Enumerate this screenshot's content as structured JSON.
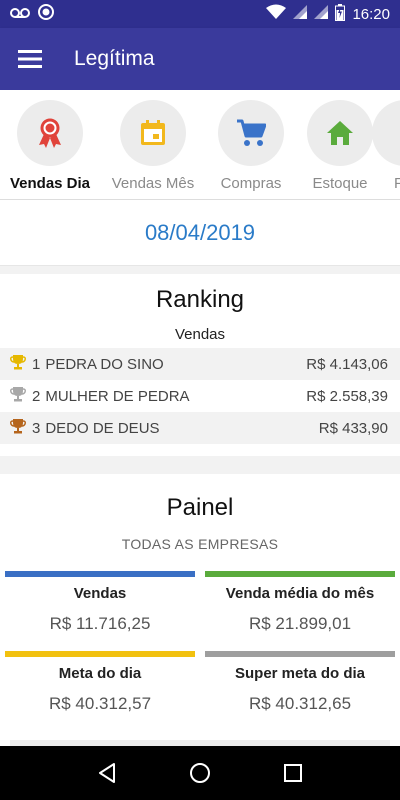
{
  "status_bar": {
    "time": "16:20"
  },
  "app_bar": {
    "title": "Legítima"
  },
  "tabs": [
    {
      "label": "Vendas Dia",
      "icon": "award-ribbon-icon",
      "color": "#e0433a",
      "active": true
    },
    {
      "label": "Vendas Mês",
      "icon": "calendar-icon",
      "color": "#f2b81c",
      "active": false
    },
    {
      "label": "Compras",
      "icon": "shopping-cart-icon",
      "color": "#3a73c9",
      "active": false
    },
    {
      "label": "Estoque",
      "icon": "home-icon",
      "color": "#5aab3c",
      "active": false
    },
    {
      "label": "F",
      "icon": "partial-tab",
      "color": "#888888",
      "active": false
    }
  ],
  "date": "08/04/2019",
  "ranking": {
    "title": "Ranking",
    "subtitle": "Vendas",
    "rows": [
      {
        "position": "1",
        "name": "PEDRA DO SINO",
        "value": "R$ 4.143,06",
        "trophy_color": "#e6b800"
      },
      {
        "position": "2",
        "name": "MULHER DE PEDRA",
        "value": "R$ 2.558,39",
        "trophy_color": "#a8a8a8"
      },
      {
        "position": "3",
        "name": "DEDO DE DEUS",
        "value": "R$ 433,90",
        "trophy_color": "#b5651d"
      }
    ]
  },
  "painel": {
    "title": "Painel",
    "subtitle": "TODAS AS EMPRESAS",
    "cards": [
      {
        "label": "Vendas",
        "value": "R$ 11.716,25",
        "color": "#3a6fc4"
      },
      {
        "label": "Venda média do mês",
        "value": "R$ 21.899,01",
        "color": "#5aab3c"
      },
      {
        "label": "Meta do dia",
        "value": "R$ 40.312,57",
        "color": "#f2c10f"
      },
      {
        "label": "Super meta do dia",
        "value": "R$ 40.312,65",
        "color": "#9e9e9e"
      }
    ]
  }
}
